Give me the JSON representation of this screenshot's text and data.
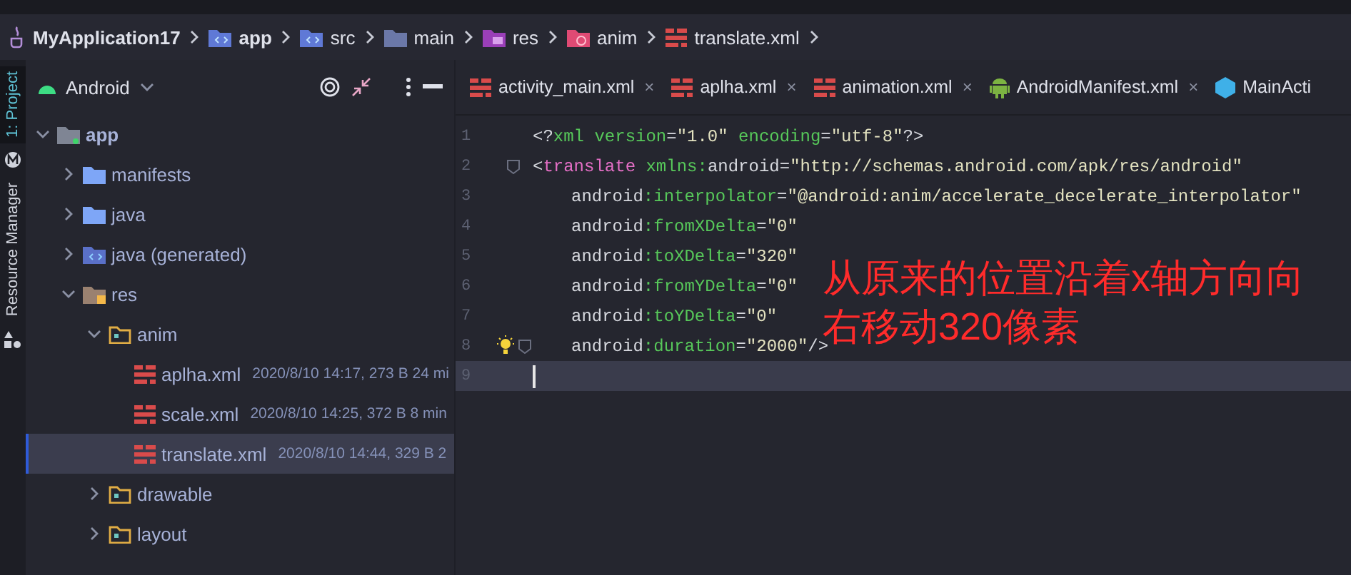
{
  "breadcrumbs": [
    {
      "label": "MyApplication17",
      "kind": "project"
    },
    {
      "label": "app",
      "kind": "module"
    },
    {
      "label": "src",
      "kind": "module"
    },
    {
      "label": "main",
      "kind": "folder"
    },
    {
      "label": "res",
      "kind": "res"
    },
    {
      "label": "anim",
      "kind": "anim"
    },
    {
      "label": "translate.xml",
      "kind": "xml"
    }
  ],
  "tool_strip": [
    {
      "label": "1: Project",
      "selected": true
    },
    {
      "label": "Resource Manager",
      "selected": false
    }
  ],
  "project_panel": {
    "view": "Android",
    "tree": [
      {
        "label": "app",
        "kind": "module",
        "expanded": true,
        "selected": false,
        "children": [
          {
            "label": "manifests",
            "kind": "folder",
            "expanded": false,
            "selected": false
          },
          {
            "label": "java",
            "kind": "folder",
            "expanded": false,
            "selected": false
          },
          {
            "label": "java (generated)",
            "kind": "generated",
            "expanded": false,
            "selected": false
          },
          {
            "label": "res",
            "kind": "res",
            "expanded": true,
            "selected": false,
            "children": [
              {
                "label": "anim",
                "kind": "resdir",
                "expanded": true,
                "selected": false,
                "children": [
                  {
                    "label": "aplha.xml",
                    "kind": "xml",
                    "meta": "2020/8/10 14:17, 273 B 24 mi",
                    "selected": false
                  },
                  {
                    "label": "scale.xml",
                    "kind": "xml",
                    "meta": "2020/8/10 14:25, 372 B 8 min",
                    "selected": false
                  },
                  {
                    "label": "translate.xml",
                    "kind": "xml",
                    "meta": "2020/8/10 14:44, 329 B 2",
                    "selected": true
                  }
                ]
              },
              {
                "label": "drawable",
                "kind": "resdir",
                "expanded": false,
                "selected": false
              },
              {
                "label": "layout",
                "kind": "resdir",
                "expanded": false,
                "selected": false
              }
            ]
          }
        ]
      }
    ]
  },
  "editor_tabs": [
    {
      "label": "activity_main.xml",
      "kind": "xml",
      "close": "×"
    },
    {
      "label": "aplha.xml",
      "kind": "xml",
      "close": "×"
    },
    {
      "label": "animation.xml",
      "kind": "xml",
      "close": "×"
    },
    {
      "label": "AndroidManifest.xml",
      "kind": "android",
      "close": "×"
    },
    {
      "label": "MainActi",
      "kind": "class"
    }
  ],
  "code_lines": [
    {
      "number": "1",
      "indented": false,
      "selected": false,
      "fold": false,
      "bulb": false,
      "segments": [
        {
          "t": "<?",
          "kind": "punct"
        },
        {
          "t": "xml version",
          "kind": "attr"
        },
        {
          "t": "=",
          "kind": "punct"
        },
        {
          "t": "\"1.0\"",
          "kind": "string"
        },
        {
          "t": " encoding",
          "kind": "attr"
        },
        {
          "t": "=",
          "kind": "punct"
        },
        {
          "t": "\"utf-8\"",
          "kind": "string"
        },
        {
          "t": "?>",
          "kind": "punct"
        }
      ]
    },
    {
      "number": "2",
      "indented": false,
      "selected": false,
      "fold": true,
      "bulb": false,
      "segments": [
        {
          "t": "<",
          "kind": "punct"
        },
        {
          "t": "translate",
          "kind": "tag"
        },
        {
          "t": " xmlns:",
          "kind": "attr"
        },
        {
          "t": "android",
          "kind": "punct"
        },
        {
          "t": "=",
          "kind": "punct"
        },
        {
          "t": "\"http://schemas.android.com/apk/res/android\"",
          "kind": "string"
        }
      ]
    },
    {
      "number": "3",
      "indented": true,
      "selected": false,
      "fold": false,
      "bulb": false,
      "segments": [
        {
          "t": "android",
          "kind": "punct"
        },
        {
          "t": ":interpolator",
          "kind": "attr"
        },
        {
          "t": "=",
          "kind": "punct"
        },
        {
          "t": "\"@android:anim/accelerate_decelerate_interpolator\"",
          "kind": "string"
        }
      ]
    },
    {
      "number": "4",
      "indented": true,
      "selected": false,
      "fold": false,
      "bulb": false,
      "segments": [
        {
          "t": "android",
          "kind": "punct"
        },
        {
          "t": ":fromXDelta",
          "kind": "attr"
        },
        {
          "t": "=",
          "kind": "punct"
        },
        {
          "t": "\"0\"",
          "kind": "string"
        }
      ]
    },
    {
      "number": "5",
      "indented": true,
      "selected": false,
      "fold": false,
      "bulb": false,
      "segments": [
        {
          "t": "android",
          "kind": "punct"
        },
        {
          "t": ":toXDelta",
          "kind": "attr"
        },
        {
          "t": "=",
          "kind": "punct"
        },
        {
          "t": "\"320\"",
          "kind": "string"
        }
      ]
    },
    {
      "number": "6",
      "indented": true,
      "selected": false,
      "fold": false,
      "bulb": false,
      "segments": [
        {
          "t": "android",
          "kind": "punct"
        },
        {
          "t": ":fromYDelta",
          "kind": "attr"
        },
        {
          "t": "=",
          "kind": "punct"
        },
        {
          "t": "\"0\"",
          "kind": "string"
        }
      ]
    },
    {
      "number": "7",
      "indented": true,
      "selected": false,
      "fold": false,
      "bulb": false,
      "segments": [
        {
          "t": "android",
          "kind": "punct"
        },
        {
          "t": ":toYDelta",
          "kind": "attr"
        },
        {
          "t": "=",
          "kind": "punct"
        },
        {
          "t": "\"0\"",
          "kind": "string"
        }
      ]
    },
    {
      "number": "8",
      "indented": true,
      "selected": false,
      "fold": true,
      "bulb": true,
      "segments": [
        {
          "t": "android",
          "kind": "punct"
        },
        {
          "t": ":duration",
          "kind": "attr"
        },
        {
          "t": "=",
          "kind": "punct"
        },
        {
          "t": "\"2000\"",
          "kind": "string"
        },
        {
          "t": "/>",
          "kind": "punct"
        }
      ]
    },
    {
      "number": "9",
      "selected": true,
      "fold": false,
      "bulb": false
    }
  ],
  "annotation": [
    "从原来的位置沿着x轴方向向",
    "右移动320像素"
  ]
}
